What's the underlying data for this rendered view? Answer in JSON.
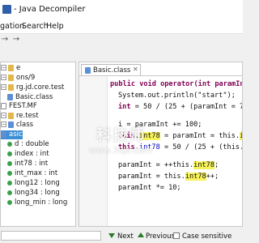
{
  "window": {
    "title": "- Java Decompiler"
  },
  "menu": {
    "items": [
      "gation",
      "Search",
      "Help"
    ]
  },
  "tree": {
    "rows": [
      {
        "label": "e",
        "kind": "folder",
        "selected": false
      },
      {
        "label": "ons/9",
        "kind": "folder",
        "selected": false
      },
      {
        "label": "rg.jd.core.test",
        "kind": "folder",
        "selected": false
      },
      {
        "label": "Basic.class",
        "kind": "class",
        "selected": false
      },
      {
        "label": "FEST.MF",
        "kind": "file",
        "selected": false
      },
      {
        "label": "re.test",
        "kind": "folder",
        "selected": false
      },
      {
        "label": "class",
        "kind": "class",
        "selected": false
      },
      {
        "label": "asic",
        "kind": "class",
        "selected": true
      },
      {
        "label": "d : double",
        "kind": "field",
        "selected": false
      },
      {
        "label": "index : int",
        "kind": "field",
        "selected": false
      },
      {
        "label": "int78 : int",
        "kind": "field",
        "selected": false
      },
      {
        "label": "int_max : int",
        "kind": "field",
        "selected": false
      },
      {
        "label": "long12 : long",
        "kind": "field",
        "selected": false
      },
      {
        "label": "long34 : long",
        "kind": "field",
        "selected": false
      },
      {
        "label": "long_min : long",
        "kind": "field",
        "selected": false
      }
    ]
  },
  "editor": {
    "tab_label": "Basic.class",
    "lines": [
      [
        [
          "public void operator(int paramInt) {",
          "kw"
        ]
      ],
      [
        [
          "System.out.println(\"start\");",
          ""
        ]
      ],
      [
        [
          "int",
          "kw"
        ],
        [
          " = 50 / (25 + (paramInt = 7",
          ""
        ]
      ],
      [
        [
          "i = paramInt += 100;",
          ""
        ]
      ],
      [
        [
          "this",
          "kw"
        ],
        [
          ".",
          ""
        ],
        [
          "int78",
          "hl"
        ],
        [
          " = paramInt = this.",
          ""
        ],
        [
          "int",
          "hl"
        ]
      ],
      [
        [
          "this",
          "kw"
        ],
        [
          ".",
          ""
        ],
        [
          "int78",
          "fld"
        ],
        [
          " = 50 / (25 + (this.",
          ""
        ],
        [
          "int",
          "hl"
        ]
      ],
      [
        [
          "paramInt = ++this.",
          ""
        ],
        [
          "int78",
          "hl"
        ],
        [
          ";",
          ""
        ]
      ],
      [
        [
          "paramInt = this.",
          ""
        ],
        [
          "int78",
          "hl"
        ],
        [
          "++;",
          ""
        ]
      ],
      [
        [
          "paramInt *= 10;",
          ""
        ]
      ]
    ]
  },
  "findbar": {
    "next_label": "Next",
    "previous_label": "Previous",
    "case_label": "Case sensitive"
  },
  "watermark": {
    "line1": "科技师",
    "line2": "www.3kjs.com"
  }
}
